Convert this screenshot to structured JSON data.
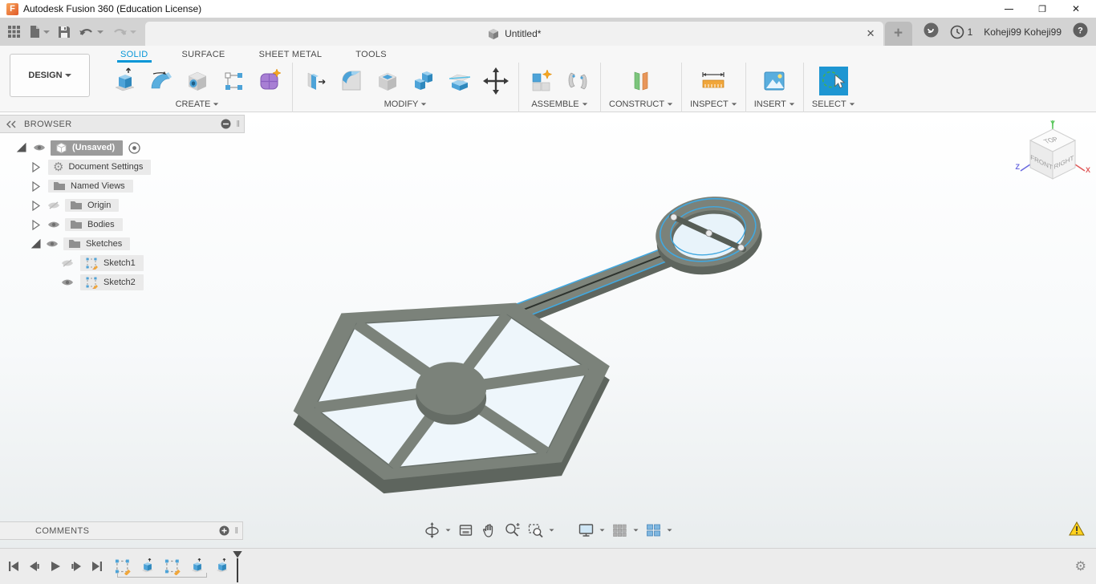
{
  "window": {
    "title": "Autodesk Fusion 360 (Education License)"
  },
  "tabbar": {
    "doc_tab": "Untitled*",
    "notification_count": "1",
    "user": "Koheji99 Koheji99"
  },
  "ribbon": {
    "design_label": "DESIGN",
    "tabs": [
      {
        "label": "SOLID",
        "active": true
      },
      {
        "label": "SURFACE",
        "active": false
      },
      {
        "label": "SHEET METAL",
        "active": false
      },
      {
        "label": "TOOLS",
        "active": false
      }
    ],
    "groups": [
      {
        "label": "CREATE"
      },
      {
        "label": "MODIFY"
      },
      {
        "label": "ASSEMBLE"
      },
      {
        "label": "CONSTRUCT"
      },
      {
        "label": "INSPECT"
      },
      {
        "label": "INSERT"
      },
      {
        "label": "SELECT"
      }
    ]
  },
  "browser": {
    "header": "BROWSER",
    "root_label": "(Unsaved)",
    "items": [
      {
        "label": "Document Settings"
      },
      {
        "label": "Named Views"
      },
      {
        "label": "Origin"
      },
      {
        "label": "Bodies"
      },
      {
        "label": "Sketches"
      },
      {
        "label": "Sketch1"
      },
      {
        "label": "Sketch2"
      }
    ]
  },
  "comments": {
    "header": "COMMENTS"
  },
  "viewcube": {
    "top": "TOP",
    "front": "FRONT",
    "right": "RIGHT",
    "axis_x": "X",
    "axis_y": "Y",
    "axis_z": "Z"
  },
  "colors": {
    "accent_blue": "#0696d7",
    "select_button_blue": "#1e96d2",
    "model_body_gray": "#7b827a",
    "model_side_gray": "#5e655e",
    "sketch_highlight_cyan": "#41a8e0",
    "sketch_profile_blue": "#e8f3fa",
    "warning_yellow": "#f8c200",
    "axis_x_red": "#e05a5a",
    "axis_y_green": "#58c65a",
    "axis_z_blue": "#6a6ae0"
  },
  "icons": [
    "fusion-logo",
    "app-grid-icon",
    "file-icon",
    "save-icon",
    "undo-icon",
    "redo-icon",
    "document-cube-icon",
    "close-tab-icon",
    "new-tab-icon",
    "extensions-icon",
    "notification-clock-icon",
    "help-icon",
    "extrude-icon",
    "revolve-icon",
    "hole-icon",
    "create-sketch-icon",
    "create-form-icon",
    "press-pull-icon",
    "fillet-icon",
    "shell-icon",
    "combine-icon",
    "split-body-icon",
    "move-copy-icon",
    "new-component-icon",
    "joint-icon",
    "construct-plane-icon",
    "measure-icon",
    "insert-image-icon",
    "select-icon",
    "eye-icon",
    "eye-off-icon",
    "folder-icon",
    "gear-icon",
    "component-cube-icon",
    "activate-radio-icon",
    "sketch-icon",
    "orbit-icon",
    "look-at-icon",
    "pan-icon",
    "zoom-icon",
    "zoom-window-icon",
    "display-settings-icon",
    "grid-icon",
    "viewports-icon",
    "go-to-start-icon",
    "step-back-icon",
    "play-icon",
    "step-forward-icon",
    "go-to-end-icon",
    "warning-icon",
    "timeline-gear-icon",
    "view-cube"
  ]
}
